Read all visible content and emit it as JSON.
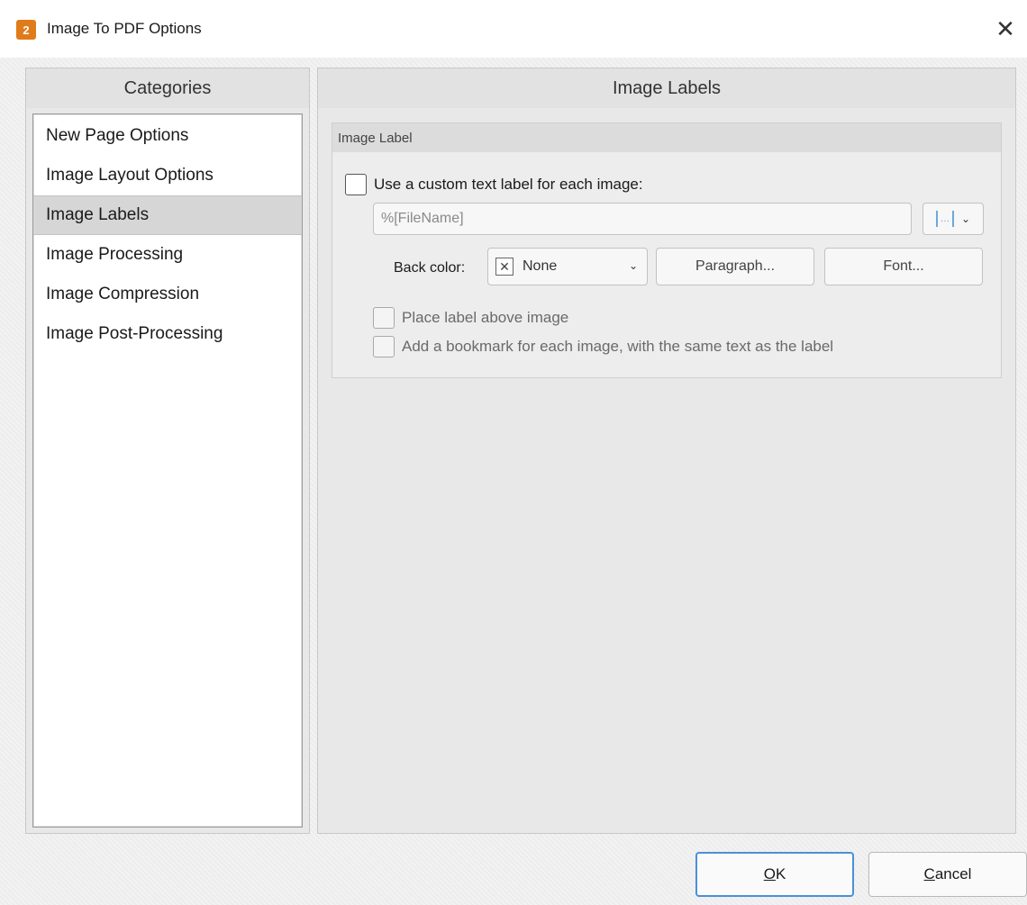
{
  "window": {
    "title": "Image To PDF Options",
    "close_glyph": "✕",
    "app_icon_glyph": "2"
  },
  "categories": {
    "header": "Categories",
    "items": [
      {
        "label": "New Page Options",
        "selected": false
      },
      {
        "label": "Image Layout Options",
        "selected": false
      },
      {
        "label": "Image Labels",
        "selected": true
      },
      {
        "label": "Image Processing",
        "selected": false
      },
      {
        "label": "Image Compression",
        "selected": false
      },
      {
        "label": "Image Post-Processing",
        "selected": false
      }
    ]
  },
  "main": {
    "header": "Image Labels",
    "group_title": "Image Label",
    "custom_label_checkbox": {
      "label": "Use a custom text label for each image:",
      "checked": false
    },
    "label_input": {
      "value": "%[FileName]",
      "placeholder": ""
    },
    "macro_button": {
      "icon": "macro-insert-icon",
      "glyph": "[…]"
    },
    "back_color": {
      "label": "Back color:",
      "selected": "None",
      "swatch_glyph": "✕"
    },
    "paragraph_button": "Paragraph...",
    "font_button": "Font...",
    "place_above_checkbox": {
      "label": "Place label above image",
      "checked": false
    },
    "bookmark_checkbox": {
      "label": "Add a bookmark for each image, with the same text as the label",
      "checked": false
    }
  },
  "footer": {
    "ok": {
      "accel": "O",
      "rest": "K"
    },
    "cancel": {
      "accel": "C",
      "rest": "ancel"
    }
  },
  "colors": {
    "accent": "#4a90d9",
    "app_icon": "#e07b1a",
    "selected_item": "#d6d6d6"
  }
}
